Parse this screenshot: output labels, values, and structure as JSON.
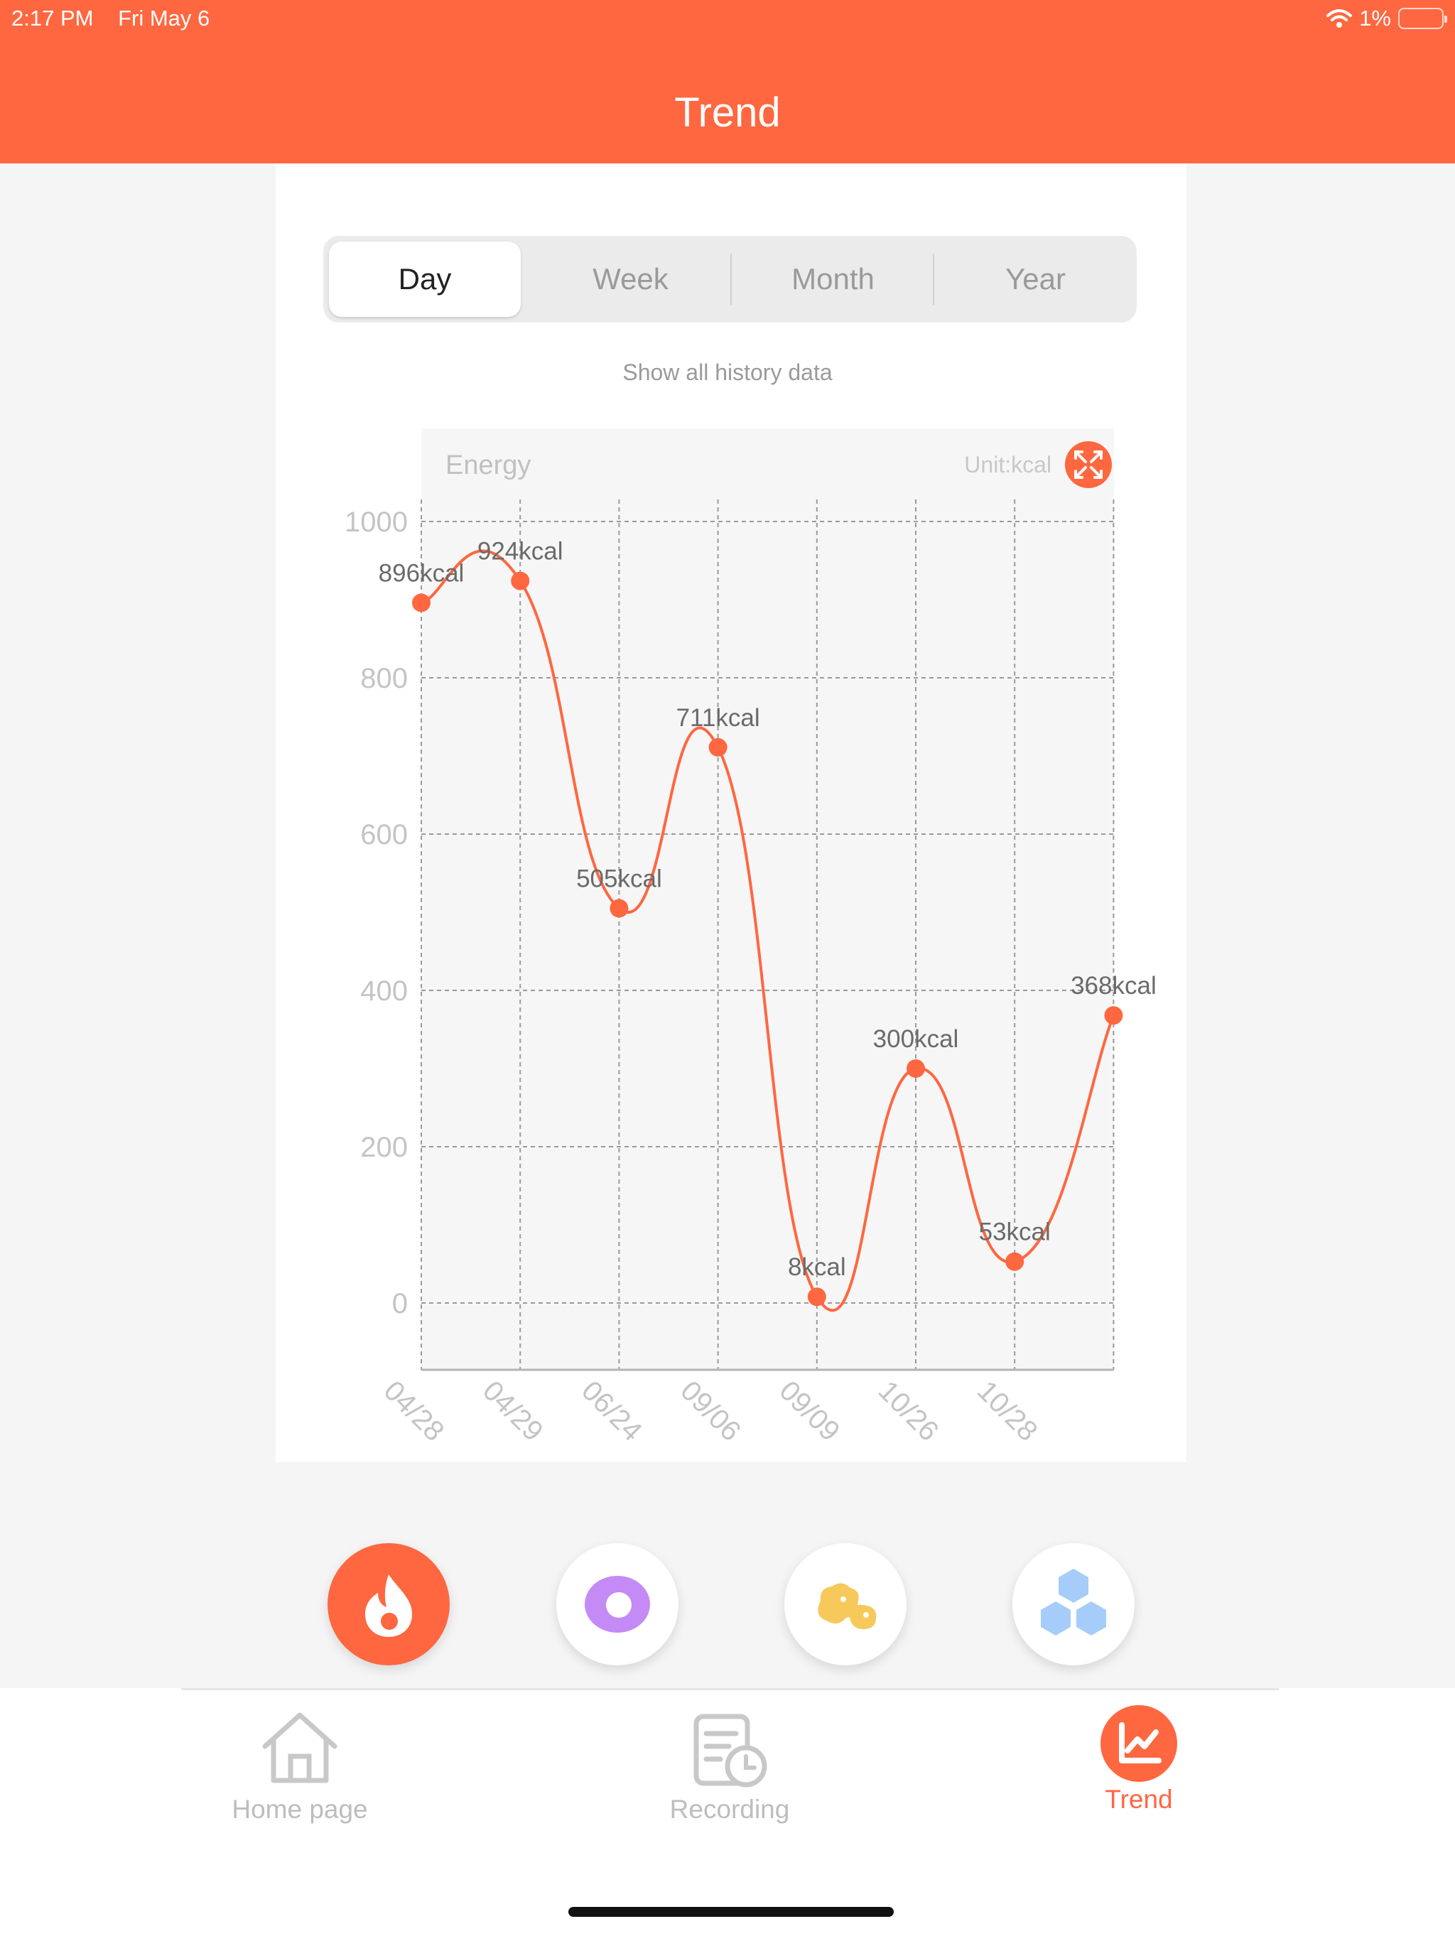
{
  "status": {
    "time": "2:17 PM",
    "date": "Fri May 6",
    "battery": "1%"
  },
  "header": {
    "title": "Trend"
  },
  "segments": [
    {
      "label": "Day",
      "active": true
    },
    {
      "label": "Week",
      "active": false
    },
    {
      "label": "Month",
      "active": false
    },
    {
      "label": "Year",
      "active": false
    }
  ],
  "history_link": "Show all history data",
  "chart_data": {
    "type": "line",
    "title": "Energy",
    "unit": "Unit:kcal",
    "categories": [
      "04/28",
      "04/29",
      "06/24",
      "09/06",
      "09/09",
      "10/26",
      "10/28",
      ""
    ],
    "series": [
      {
        "values": [
          896,
          924,
          505,
          711,
          8,
          300,
          53,
          368
        ]
      }
    ],
    "data_labels": [
      "896kcal",
      "924kcal",
      "505kcal",
      "711kcal",
      "8kcal",
      "300kcal",
      "53kcal",
      "368kcal"
    ],
    "yticks": [
      "0",
      "200",
      "400",
      "600",
      "800",
      "1000"
    ],
    "ylim": [
      0,
      1000
    ],
    "grid": true,
    "color": "#ff6740"
  },
  "metrics": [
    {
      "icon": "flame-icon",
      "active": true
    },
    {
      "icon": "ring-icon",
      "active": false
    },
    {
      "icon": "blobs-icon",
      "active": false
    },
    {
      "icon": "hexagons-icon",
      "active": false
    }
  ],
  "tabs": [
    {
      "label": "Home page",
      "icon": "home-icon"
    },
    {
      "label": "Recording",
      "icon": "record-icon"
    },
    {
      "label": "Trend",
      "icon": "trend-icon",
      "active": true
    }
  ],
  "colors": {
    "accent": "#ff6740",
    "inactive": "#bdbdbd"
  }
}
